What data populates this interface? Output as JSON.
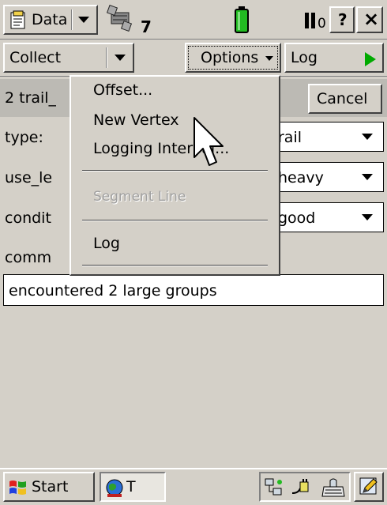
{
  "top_bar": {
    "data_button": "Data",
    "satellite_count": "7",
    "signal_value": "0",
    "help_label": "?",
    "close_label": "×"
  },
  "second_bar": {
    "collect_label": "Collect",
    "options_label": "Options",
    "log_label": "Log"
  },
  "form": {
    "header_title": "2 trail_",
    "cancel_label": "Cancel",
    "fields": [
      {
        "label": "type:",
        "value": "rail"
      },
      {
        "label": "use_le",
        "value": "heavy"
      },
      {
        "label": "condit",
        "value": "good"
      }
    ],
    "comment_label": "comm",
    "comment_value": "encountered 2 large groups"
  },
  "menu": {
    "items": [
      "Offset...",
      "New Vertex",
      "Logging Interval...",
      "Segment Line",
      "Log"
    ],
    "disabled_items": [
      "Segment Line"
    ]
  },
  "taskbar": {
    "start_label": "Start",
    "task_label": "T"
  },
  "colors": {
    "surface": "#d4d0c8",
    "log_arrow": "#00aa00",
    "battery": "#22bb22"
  }
}
